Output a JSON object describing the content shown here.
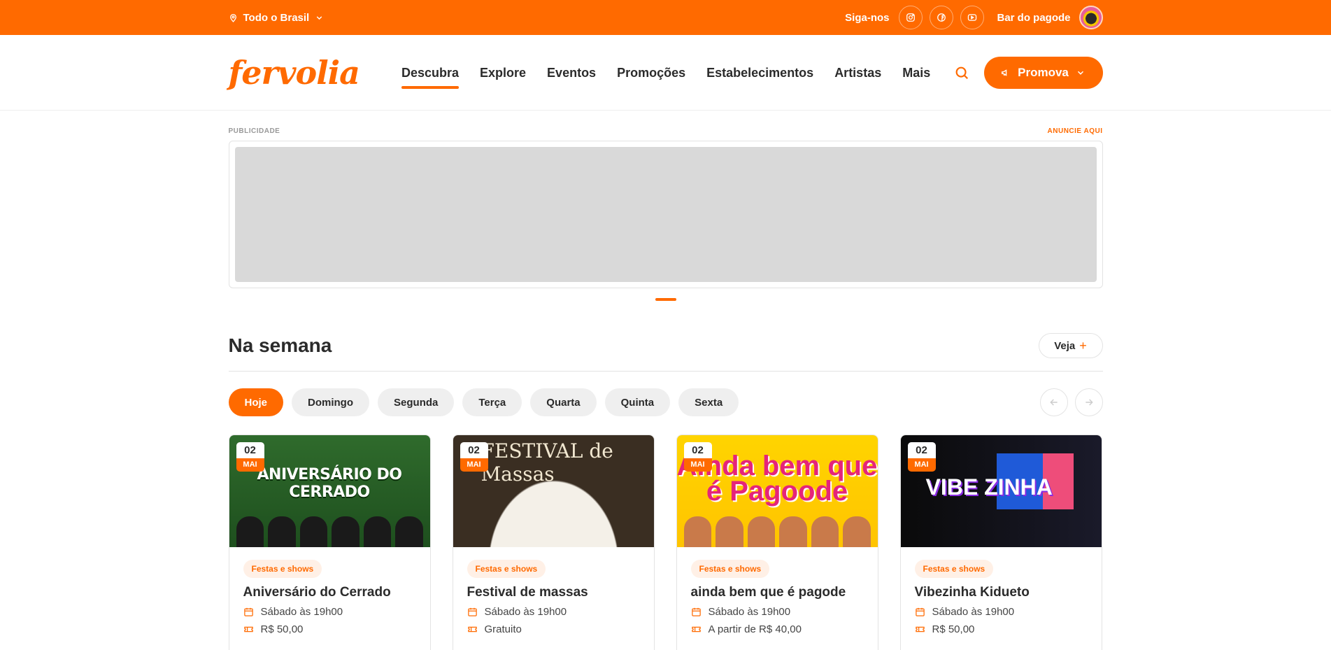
{
  "topbar": {
    "location": "Todo o Brasil",
    "follow_label": "Siga-nos",
    "user_name": "Bar do pagode"
  },
  "nav": {
    "logo": "fervolia",
    "items": [
      {
        "label": "Descubra",
        "active": true
      },
      {
        "label": "Explore"
      },
      {
        "label": "Eventos"
      },
      {
        "label": "Promoções"
      },
      {
        "label": "Estabelecimentos"
      },
      {
        "label": "Artistas"
      },
      {
        "label": "Mais"
      }
    ],
    "cta": "Promova"
  },
  "ads": {
    "label": "PUBLICIDADE",
    "link": "ANUNCIE AQUI"
  },
  "section": {
    "title": "Na semana",
    "see_more": "Veja",
    "days": [
      "Hoje",
      "Domingo",
      "Segunda",
      "Terça",
      "Quarta",
      "Quinta",
      "Sexta"
    ]
  },
  "cards": [
    {
      "day": "02",
      "month": "MAI",
      "category": "Festas e shows",
      "title": "Aniversário do Cerrado",
      "when": "Sábado às 19h00",
      "price": "R$ 50,00",
      "image_text": "ANIVERSÁRIO DO CERRADO"
    },
    {
      "day": "02",
      "month": "MAI",
      "category": "Festas e shows",
      "title": "Festival de massas",
      "when": "Sábado às 19h00",
      "price": "Gratuito",
      "image_text": "FESTIVAL de Massas"
    },
    {
      "day": "02",
      "month": "MAI",
      "category": "Festas e shows",
      "title": "ainda bem que é pagode",
      "when": "Sábado às 19h00",
      "price": "A partir de R$ 40,00",
      "image_text": "Ainda bem que é Pagoode"
    },
    {
      "day": "02",
      "month": "MAI",
      "category": "Festas e shows",
      "title": "Vibezinha Kidueto",
      "when": "Sábado às 19h00",
      "price": "R$ 50,00",
      "image_text": "VIBE ZINHA"
    }
  ],
  "icons": {
    "location": "map-pin-icon",
    "social": [
      "instagram-icon",
      "facebook-icon",
      "youtube-icon"
    ],
    "search": "search-icon",
    "megaphone": "megaphone-icon",
    "calendar": "calendar-icon",
    "ticket": "ticket-icon"
  },
  "colors": {
    "accent": "#ff6a00",
    "chip_bg": "#efefef",
    "tag_bg": "#fff0e6"
  }
}
